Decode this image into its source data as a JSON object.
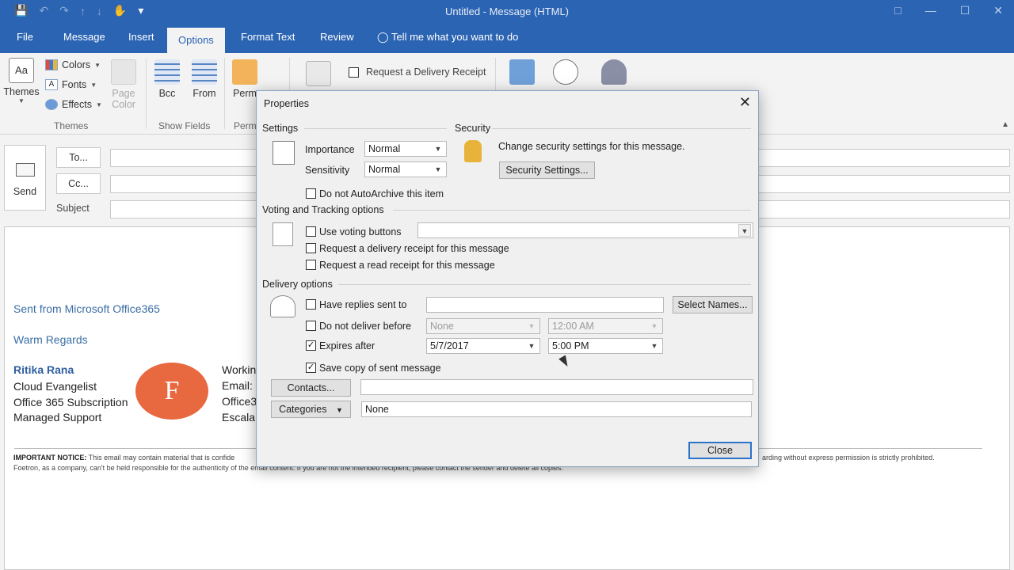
{
  "window": {
    "title": "Untitled  -  Message (HTML)"
  },
  "tabs": [
    "File",
    "Message",
    "Insert",
    "Options",
    "Format Text",
    "Review",
    "Tell me what you want to do"
  ],
  "ribbon": {
    "themes_label": "Themes",
    "colors_label": "Colors",
    "fonts_label": "Fonts",
    "effects_label": "Effects",
    "page_color_line1": "Page",
    "page_color_line2": "Color",
    "group_themes": "Themes",
    "bcc_label": "Bcc",
    "from_label": "From",
    "group_show_fields": "Show Fields",
    "perm_label": "Perm",
    "group_perm": "Perm",
    "delivery_receipt_label": "Request a Delivery Receipt"
  },
  "compose": {
    "send_label": "Send",
    "to_label": "To...",
    "cc_label": "Cc...",
    "subject_label": "Subject"
  },
  "signature": {
    "sent_from": "Sent from Microsoft Office365",
    "regards": "Warm Regards",
    "name": "Ritika Rana",
    "line1": "Cloud Evangelist",
    "line2": "Office 365 Subscription",
    "line3": "Managed Support",
    "badge_letter": "F",
    "right1": "Workin",
    "right2": "Email:",
    "right3": "Office3",
    "right4": "Escala",
    "notice_bold": "IMPORTANT NOTICE:",
    "notice_text": "This email may contain material that is confide",
    "notice_tail": "arding without express permission is strictly prohibited.",
    "notice_line2": "Foetron, as a company, can't be held responsible for the authenticity of the email content. If you are not the intended recipient, please contact the sender and delete all copies."
  },
  "dialog": {
    "title": "Properties",
    "settings_header": "Settings",
    "security_header": "Security",
    "importance_label": "Importance",
    "importance_value": "Normal",
    "sensitivity_label": "Sensitivity",
    "sensitivity_value": "Normal",
    "security_text": "Change security settings for this message.",
    "security_button": "Security Settings...",
    "autoarchive_label": "Do not AutoArchive this item",
    "voting_header": "Voting and Tracking options",
    "voting_label": "Use voting buttons",
    "delivery_receipt_label": "Request a delivery receipt for this message",
    "read_receipt_label": "Request a read receipt for this message",
    "delivery_header": "Delivery options",
    "replies_label": "Have replies sent to",
    "select_names_button": "Select Names...",
    "not_before_label": "Do not deliver before",
    "not_before_date": "None",
    "not_before_time": "12:00 AM",
    "expires_label": "Expires after",
    "expires_date": "5/7/2017",
    "expires_time": "5:00 PM",
    "save_copy_label": "Save copy of sent message",
    "contacts_button": "Contacts...",
    "categories_button": "Categories",
    "categories_value": "None",
    "close_button": "Close"
  },
  "colors": {
    "accent": "#2b64b3",
    "badge": "#e8683f"
  }
}
